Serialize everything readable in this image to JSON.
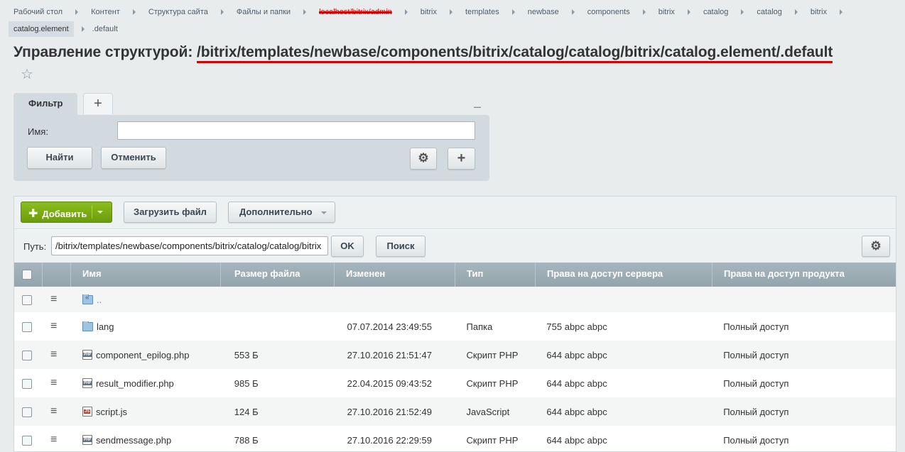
{
  "breadcrumb": {
    "row1": [
      "Рабочий стол",
      "Контент",
      "Структура сайта",
      "Файлы и папки",
      "localhost/bitrix/admin",
      "bitrix",
      "templates",
      "newbase",
      "components",
      "bitrix",
      "catalog",
      "catalog",
      "bitrix"
    ],
    "row2": [
      "catalog.element",
      ".default"
    ]
  },
  "title": {
    "prefix": "Управление структурой:",
    "path": "/bitrix/templates/newbase/components/bitrix/catalog/catalog/bitrix/catalog.element/.default"
  },
  "filter": {
    "tab_label": "Фильтр",
    "add_tab": "+",
    "minimize": "–",
    "name_label": "Имя:",
    "name_value": "",
    "find_label": "Найти",
    "cancel_label": "Отменить",
    "gear": "⚙",
    "plus": "+"
  },
  "toolbar": {
    "add_label": "Добавить",
    "upload_label": "Загрузить файл",
    "more_label": "Дополнительно"
  },
  "pathbar": {
    "label": "Путь:",
    "value": "/bitrix/templates/newbase/components/bitrix/catalog/catalog/bitrix",
    "ok_label": "OK",
    "search_label": "Поиск",
    "gear": "⚙"
  },
  "table": {
    "columns": [
      "Имя",
      "Размер файла",
      "Изменен",
      "Тип",
      "Права на доступ сервера",
      "Права на доступ продукта"
    ],
    "rows": [
      {
        "icon": "folder-up-icon",
        "name": "..",
        "size": "",
        "date": "",
        "type": "",
        "srv": "",
        "prod": ""
      },
      {
        "icon": "folder-icon",
        "name": "lang",
        "size": "",
        "date": "07.07.2014 23:49:55",
        "type": "Папка",
        "srv": "755 abpc abpc",
        "prod": "Полный доступ"
      },
      {
        "icon": "php-file-icon",
        "name": "component_epilog.php",
        "size": "553 Б",
        "date": "27.10.2016 21:51:47",
        "type": "Скрипт PHP",
        "srv": "644 abpc abpc",
        "prod": "Полный доступ"
      },
      {
        "icon": "php-file-icon",
        "name": "result_modifier.php",
        "size": "985 Б",
        "date": "22.04.2015 09:43:52",
        "type": "Скрипт PHP",
        "srv": "644 abpc abpc",
        "prod": "Полный доступ"
      },
      {
        "icon": "js-file-icon",
        "name": "script.js",
        "size": "124 Б",
        "date": "27.10.2016 21:52:49",
        "type": "JavaScript",
        "srv": "644 abpc abpc",
        "prod": "Полный доступ"
      },
      {
        "icon": "php-file-icon",
        "name": "sendmessage.php",
        "size": "788 Б",
        "date": "27.10.2016 22:29:59",
        "type": "Скрипт PHP",
        "srv": "644 abpc abpc",
        "prod": "Полный доступ"
      }
    ]
  }
}
